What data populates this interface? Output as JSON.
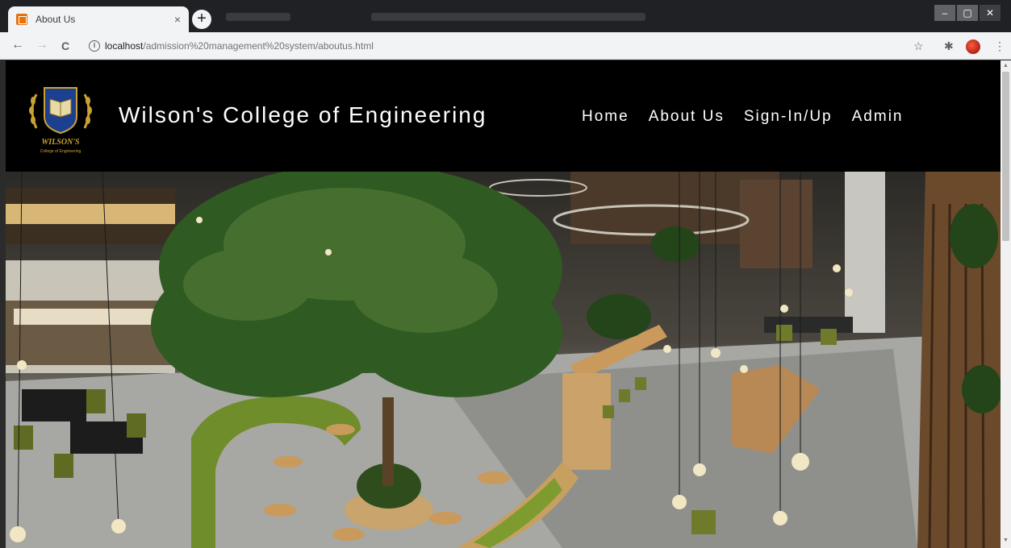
{
  "browser": {
    "tab_title": "About Us",
    "tab_close": "×",
    "new_tab": "+",
    "url_host": "localhost",
    "url_path": "/admission%20management%20system/aboutus.html",
    "nav_back": "←",
    "nav_forward": "→",
    "nav_reload": "C",
    "info_icon": "i",
    "window_controls": [
      "–",
      "▢",
      "✕"
    ],
    "toolbar_icons": [
      "☆",
      "✱",
      "⋮"
    ]
  },
  "site": {
    "brand": "Wilson's College of Engineering",
    "logo_text": "WILSON'S",
    "logo_subtext": "College of Engineering",
    "nav": [
      "Home",
      "About Us",
      "Sign-In/Up",
      "Admin"
    ]
  },
  "colors": {
    "header_bg": "#000000",
    "header_text": "#ffffff",
    "logo_gold": "#c9a233",
    "logo_blue": "#1d3f8f"
  }
}
